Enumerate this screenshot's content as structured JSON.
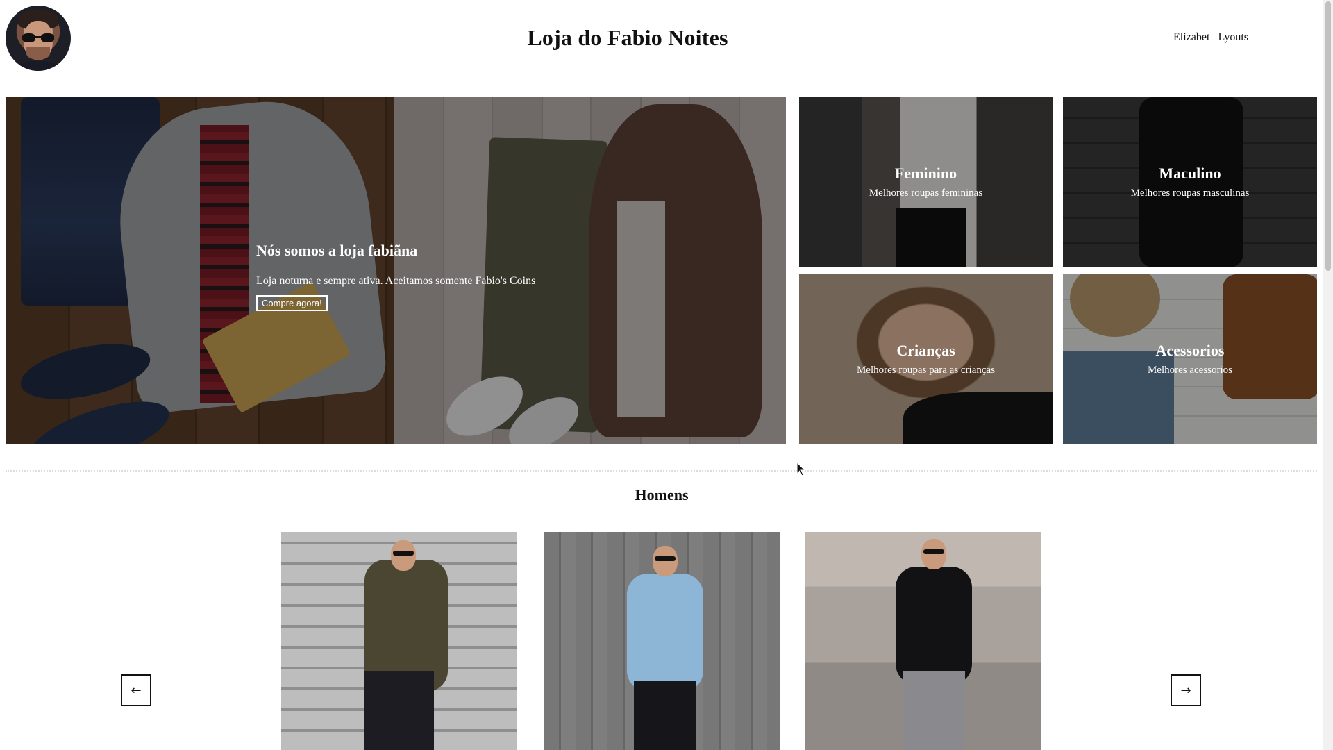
{
  "header": {
    "site_title": "Loja do Fabio Noites",
    "nav": [
      "Elizabet",
      "Lyouts"
    ]
  },
  "hero": {
    "title": "Nós somos a loja fabiãna",
    "subtitle": "Loja noturna e sempre ativa. Aceitamos somente Fabio's Coins",
    "button_label": "Compre agora!"
  },
  "categories": [
    {
      "name": "Feminino",
      "desc": "Melhores roupas femininas"
    },
    {
      "name": "Maculino",
      "desc": "Melhores roupas masculinas"
    },
    {
      "name": "Crianças",
      "desc": "Melhores roupas para as crianças"
    },
    {
      "name": "Acessorios",
      "desc": "Melhores acessorios"
    }
  ],
  "section": {
    "title": "Homens",
    "prev_label": "←",
    "next_label": "→"
  },
  "icons": {
    "avatar": "user-avatar",
    "prev": "arrow-left-icon",
    "next": "arrow-right-icon",
    "cursor": "mouse-pointer-icon"
  }
}
